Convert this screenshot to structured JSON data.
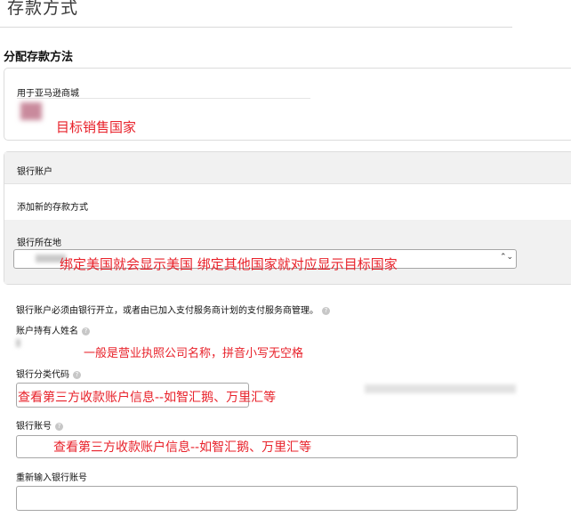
{
  "page": {
    "title": "存款方式"
  },
  "section": {
    "title": "分配存款方法"
  },
  "marketplace": {
    "label": "用于亚马逊商城",
    "annotation": "目标销售国家"
  },
  "bank_account": {
    "header": "银行账户",
    "add_method": "添加新的存款方式",
    "location_label": "银行所在地",
    "location_annotation": "绑定美国就会显示美国   绑定其他国家就对应显示目标国家",
    "select_arrow": "⌃⌄"
  },
  "form": {
    "notice": "银行账户必须由银行开立，或者由已加入支付服务商计划的支付服务商管理。",
    "holder_label": "账户持有人姓名",
    "holder_annotation": "一般是营业执照公司名称，拼音小写无空格",
    "routing_label": "银行分类代码",
    "routing_annotation": "查看第三方收款账户信息--如智汇鹅、万里汇等",
    "account_label": "银行账号",
    "account_annotation": "查看第三方收款账户信息--如智汇鹅、万里汇等",
    "reenter_label": "重新输入银行账号",
    "info_glyph": "?"
  },
  "colors": {
    "annotation_red": "#e8212a",
    "panel_gray": "#f1f1f1",
    "border": "#dcdcdc"
  }
}
